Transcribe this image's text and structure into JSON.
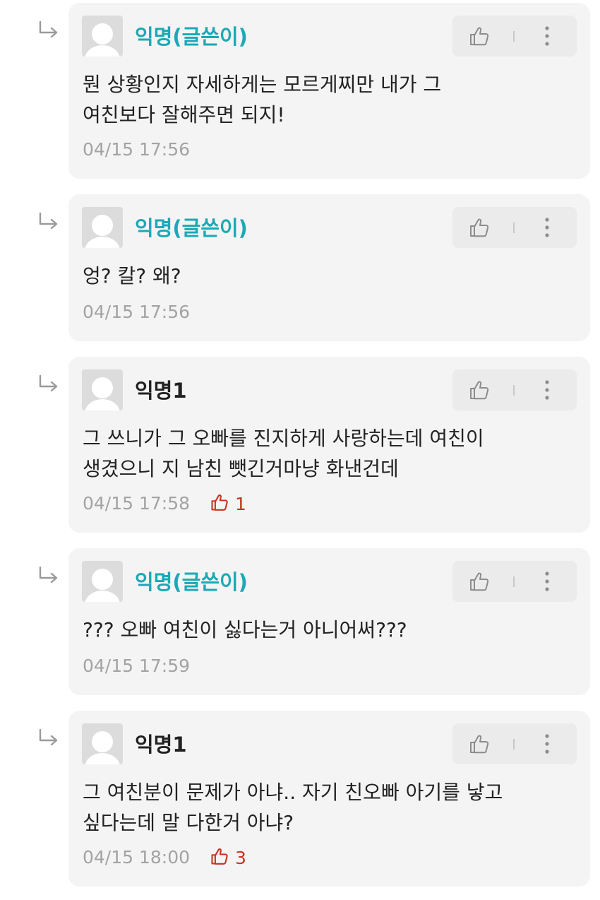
{
  "colors": {
    "op_author": "#1ba9b5",
    "anon_author": "#222222",
    "timestamp": "#a3a3a3",
    "like_count": "#c8341f",
    "card_bg": "#f4f4f4"
  },
  "comments": [
    {
      "author": "익명(글쓴이)",
      "is_op": true,
      "text": "뭔 상황인지 자세하게는 모르게찌만 내가 그\n여친보다 잘해주면 되지!",
      "timestamp": "04/15 17:56",
      "like_count": null,
      "icons": {
        "reply": "reply-arrow-icon",
        "like": "thumbs-up-icon",
        "more": "more-vertical-icon"
      }
    },
    {
      "author": "익명(글쓴이)",
      "is_op": true,
      "text": "엉? 칼? 왜?",
      "timestamp": "04/15 17:56",
      "like_count": null,
      "icons": {
        "reply": "reply-arrow-icon",
        "like": "thumbs-up-icon",
        "more": "more-vertical-icon"
      }
    },
    {
      "author": "익명1",
      "is_op": false,
      "text": "그 쓰니가 그 오빠를 진지하게 사랑하는데 여친이\n생겼으니 지 남친 뺏긴거마냥 화낸건데",
      "timestamp": "04/15 17:58",
      "like_count": "1",
      "icons": {
        "reply": "reply-arrow-icon",
        "like": "thumbs-up-icon",
        "more": "more-vertical-icon"
      }
    },
    {
      "author": "익명(글쓴이)",
      "is_op": true,
      "text": "??? 오빠 여친이 싫다는거 아니어써???",
      "timestamp": "04/15 17:59",
      "like_count": null,
      "icons": {
        "reply": "reply-arrow-icon",
        "like": "thumbs-up-icon",
        "more": "more-vertical-icon"
      }
    },
    {
      "author": "익명1",
      "is_op": false,
      "text": "그 여친분이 문제가 아냐.. 자기 친오빠 아기를 낳고\n싶다는데 말 다한거 아냐?",
      "timestamp": "04/15 18:00",
      "like_count": "3",
      "icons": {
        "reply": "reply-arrow-icon",
        "like": "thumbs-up-icon",
        "more": "more-vertical-icon"
      }
    }
  ]
}
